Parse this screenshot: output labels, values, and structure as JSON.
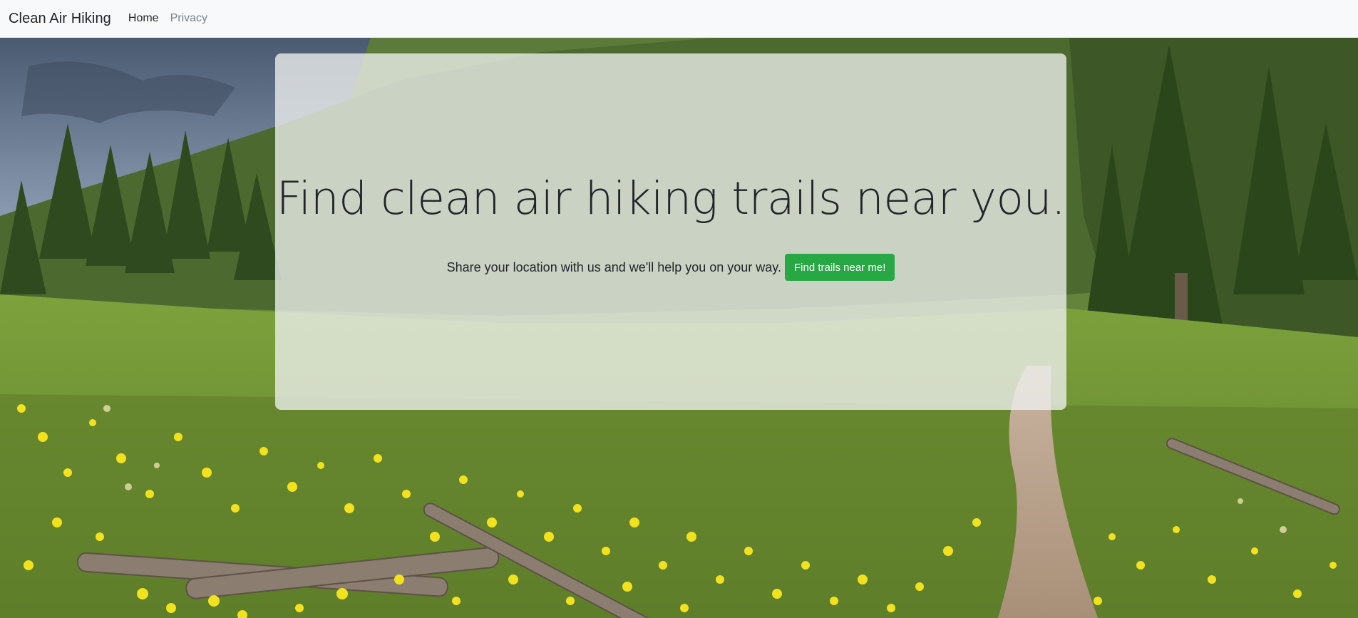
{
  "navbar": {
    "brand": "Clean Air Hiking",
    "links": [
      {
        "label": "Home",
        "active": true
      },
      {
        "label": "Privacy",
        "active": false
      }
    ]
  },
  "hero": {
    "headline": "Find clean air hiking trails near you.",
    "lead": "Share your location with us and we'll help you on your way.",
    "button_label": "Find trails near me!",
    "button_color": "#28a745"
  },
  "colors": {
    "navbar_bg": "#f8f9fa",
    "text": "#212529",
    "muted_link": "#7b8288"
  }
}
